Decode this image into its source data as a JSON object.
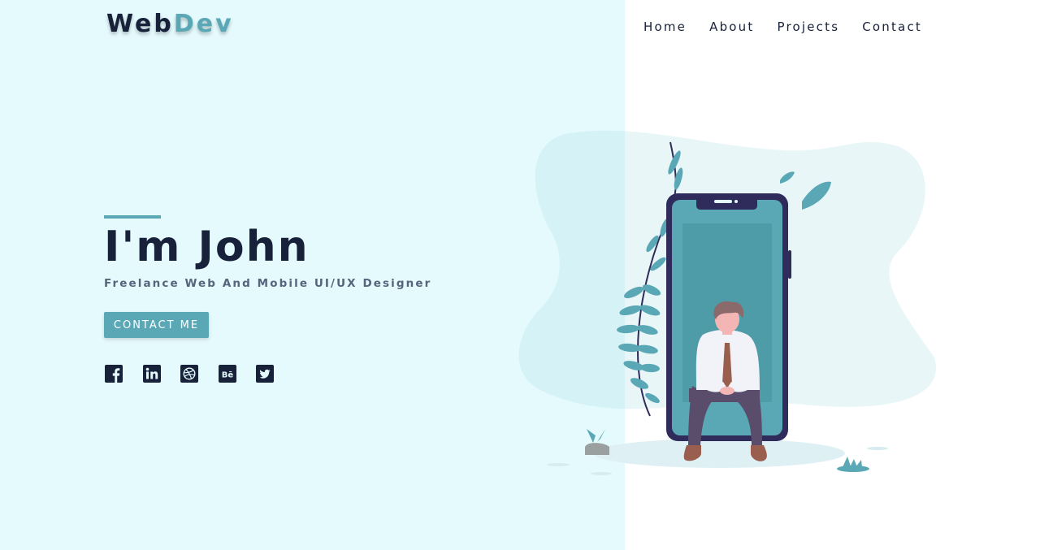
{
  "brand": {
    "part1": "Web",
    "part2": "Dev"
  },
  "nav": {
    "items": [
      "Home",
      "About",
      "Projects",
      "Contact"
    ]
  },
  "hero": {
    "title": "I'm John",
    "subtitle": "Freelance Web And Mobile UI/UX Designer",
    "cta_label": "CONTACT ME"
  },
  "social_icons": [
    "facebook-icon",
    "linkedin-icon",
    "dribbble-icon",
    "behance-icon",
    "twitter-icon"
  ],
  "social_glyphs": {
    "behance": "Bē"
  },
  "colors": {
    "left_background": "#e4fafd",
    "accent": "#5aa8b6",
    "dark_text": "#17213a",
    "phone_frame": "#2f2b5a"
  }
}
